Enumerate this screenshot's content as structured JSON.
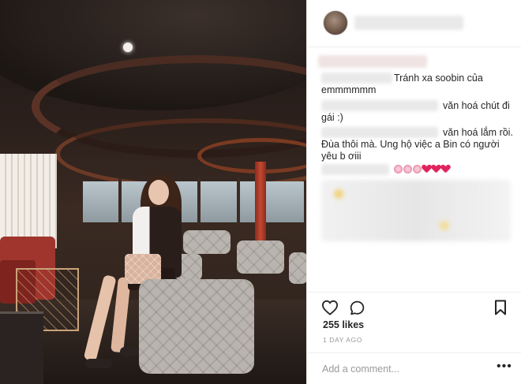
{
  "post": {
    "photo_alt": "",
    "header": {
      "username": ""
    },
    "comments": [
      {
        "text_line1": "Tránh xa soobin của",
        "text_line2": "emmmmmm"
      },
      {
        "text_line1": "văn hoá chút đi",
        "text_line2": "gái :)"
      },
      {
        "text_line1": "văn hoá lắm rồi.",
        "text_line2": "Đùa thôi mà. Ung hộ việc a Bin có người",
        "text_line3": "yêu b ơiii"
      },
      {
        "emoji": [
          "flower-icon",
          "flower-icon",
          "flower-icon",
          "heart-icon",
          "heart-icon",
          "heart-icon"
        ]
      }
    ],
    "likes": "255 likes",
    "timestamp": "1 DAY AGO",
    "add_comment_placeholder": "Add a comment...",
    "more_label": "•••"
  },
  "colors": {
    "heart": "#e0245e",
    "text": "#262626",
    "muted": "#999999",
    "divider": "#efefef"
  }
}
